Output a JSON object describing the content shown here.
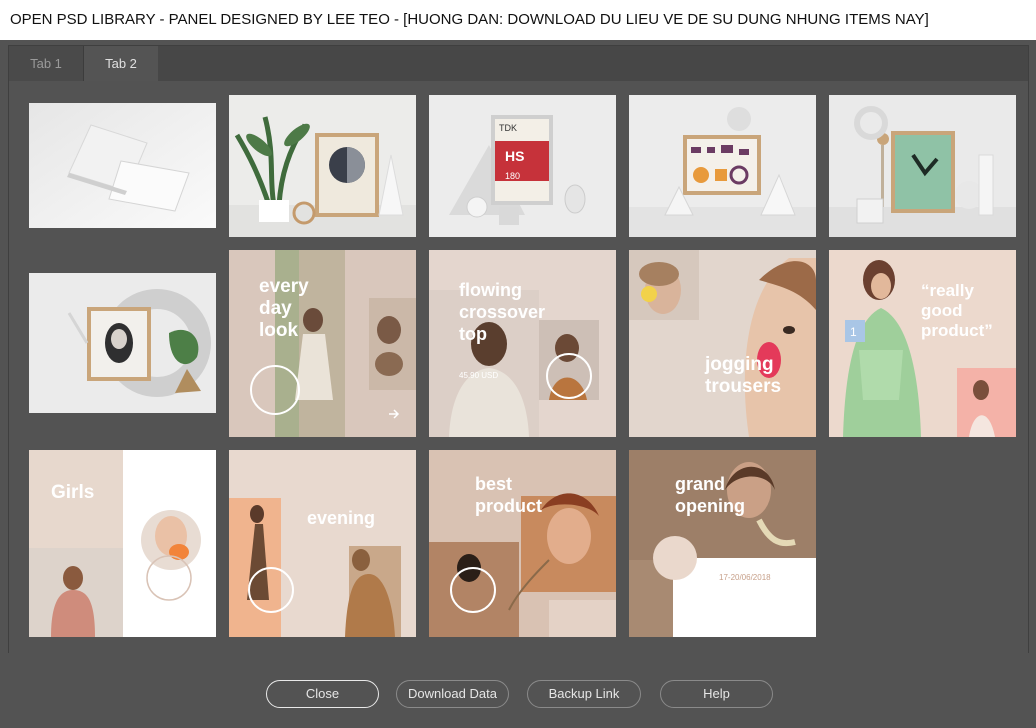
{
  "window": {
    "title": "OPEN PSD LIBRARY - PANEL DESIGNED BY LEE TEO    -     [HUONG DAN: DOWNLOAD DU LIEU VE DE SU DUNG NHUNG ITEMS NAY]"
  },
  "tabs": [
    {
      "label": "Tab 1",
      "active": false
    },
    {
      "label": "Tab 2",
      "active": true
    }
  ],
  "thumbnails": [
    {
      "name": "business-card-mockup",
      "texts": []
    },
    {
      "name": "poster-frame-plant-mockup",
      "texts": []
    },
    {
      "name": "tdk-poster-mockup",
      "texts": [
        "TDK",
        "HS",
        "180"
      ]
    },
    {
      "name": "geometric-frame-mockup",
      "texts": []
    },
    {
      "name": "green-frame-mockup",
      "texts": []
    },
    {
      "name": "round-frame-mockup",
      "texts": []
    },
    {
      "name": "every-day-look-post",
      "texts": [
        "every",
        "day",
        "look"
      ]
    },
    {
      "name": "flowing-crossover-top-post",
      "texts": [
        "flowing",
        "crossover",
        "top",
        "45.90 USD"
      ]
    },
    {
      "name": "jogging-trousers-post",
      "texts": [
        "jogging",
        "trousers"
      ]
    },
    {
      "name": "really-good-product-post",
      "texts": [
        "“really",
        "good",
        "product”",
        "1"
      ]
    },
    {
      "name": "girls-post",
      "texts": [
        "Girls"
      ]
    },
    {
      "name": "evening-post",
      "texts": [
        "evening"
      ]
    },
    {
      "name": "best-product-post",
      "texts": [
        "best",
        "product"
      ]
    },
    {
      "name": "grand-opening-post",
      "texts": [
        "grand",
        "opening",
        "17-20/06/2018"
      ]
    }
  ],
  "buttons": {
    "close": "Close",
    "download": "Download Data",
    "backup": "Backup Link",
    "help": "Help"
  }
}
